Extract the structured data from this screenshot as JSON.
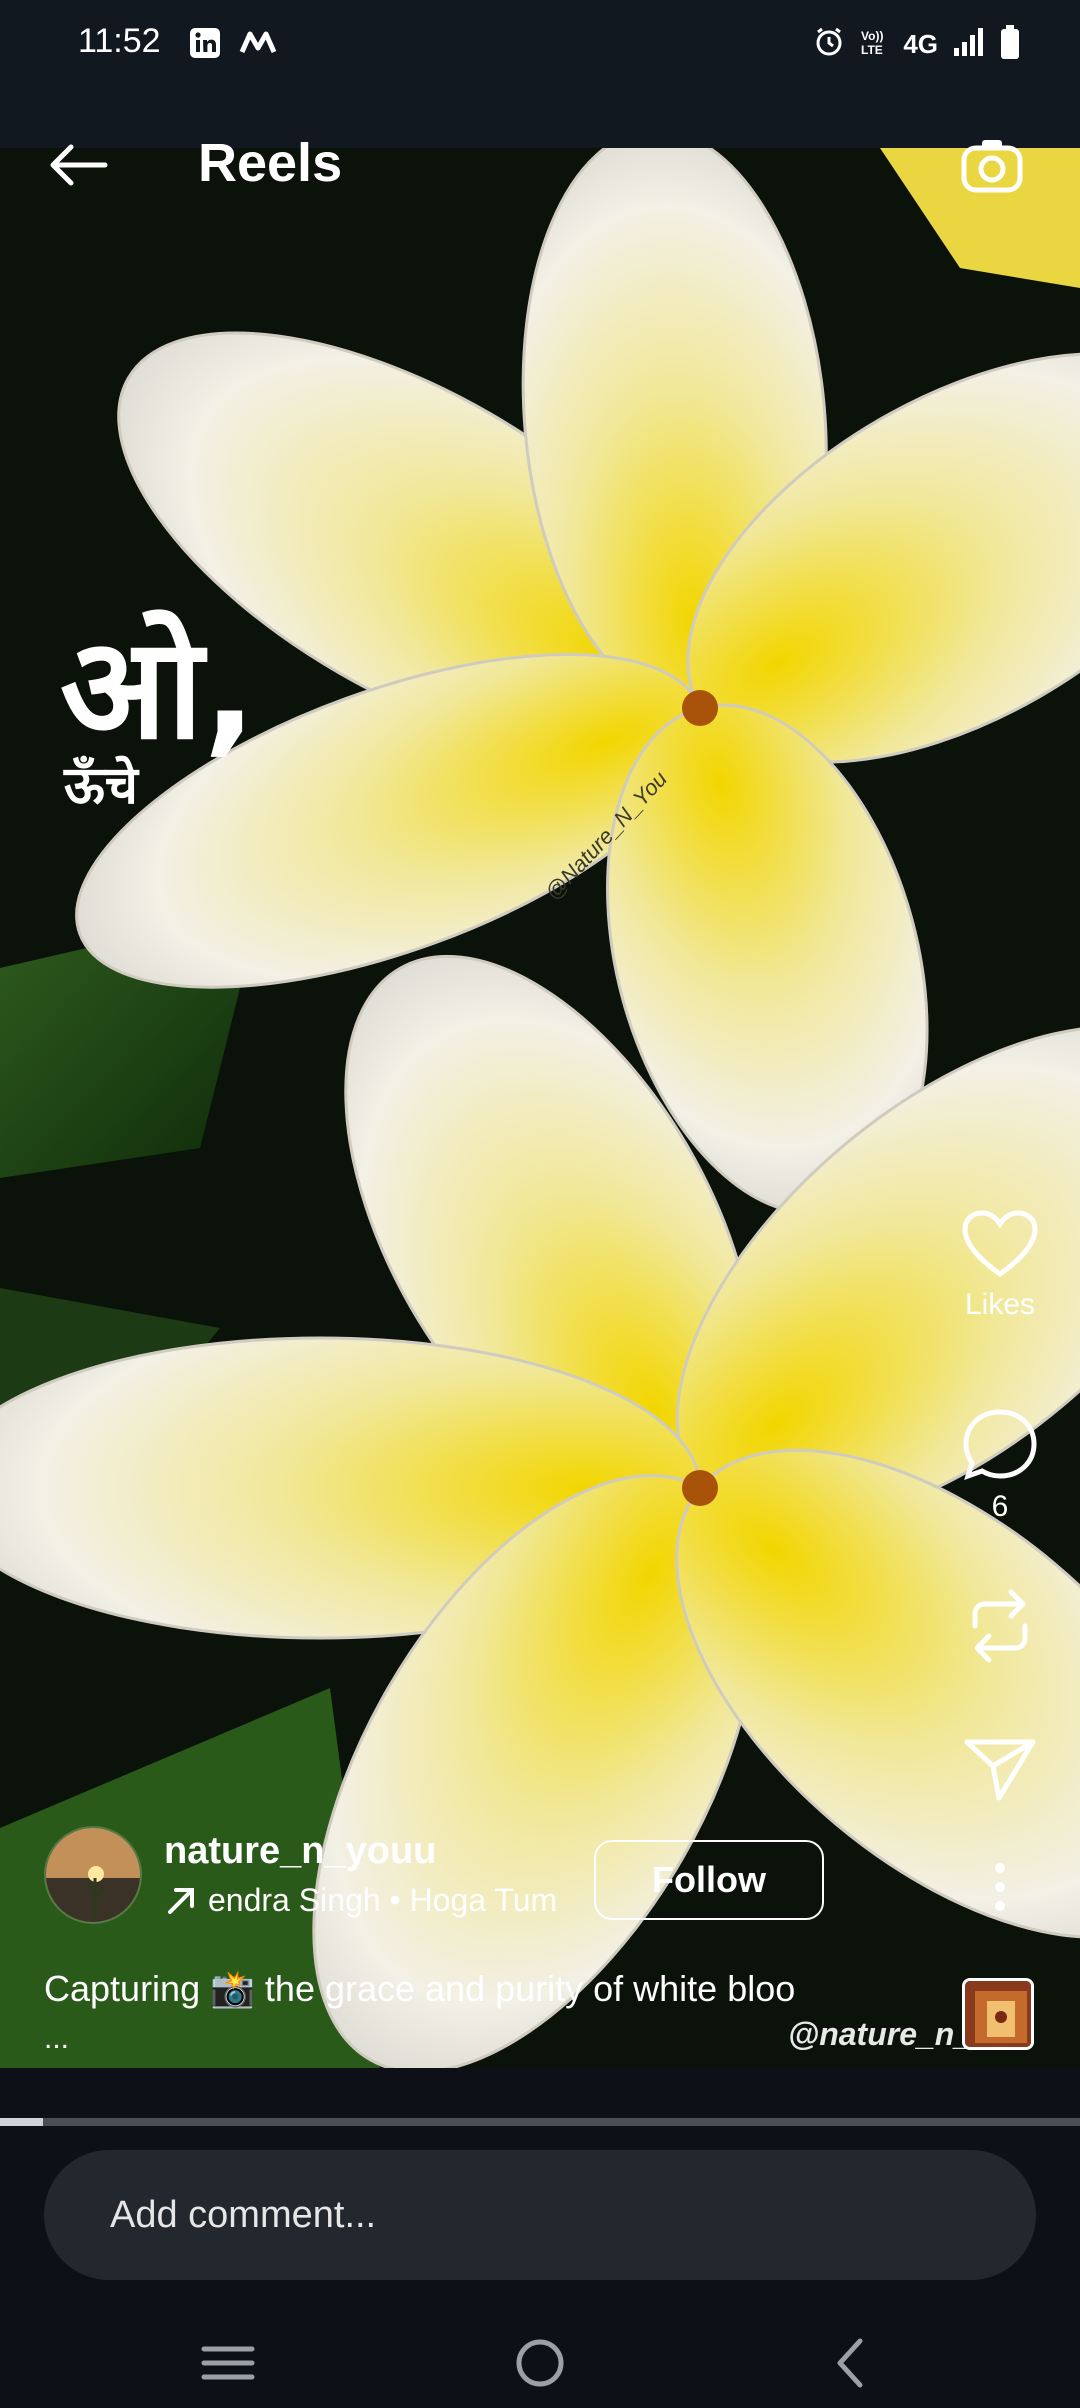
{
  "status_bar": {
    "time": "11:52",
    "right_indicators": [
      "alarm-icon",
      "volte-icon",
      "4G",
      "signal-icon",
      "battery-icon"
    ],
    "network_label": "4G"
  },
  "header": {
    "title": "Reels",
    "back_icon": "back-arrow-icon",
    "camera_icon": "camera-icon"
  },
  "video": {
    "overlay_text_1": "ओ,",
    "overlay_text_2": "ऊँचे",
    "petal_watermark": "@Nature_N_You",
    "bottom_watermark": "@nature_n_"
  },
  "actions": {
    "likes_label": "Likes",
    "comments_count": "6"
  },
  "post": {
    "username": "nature_n_youu",
    "audio": "endra Singh • Hoga Tum",
    "follow_label": "Follow",
    "caption": "Capturing 📸  the grace and purity of white bloo",
    "caption_more": "..."
  },
  "playback": {
    "progress_fraction": 0.04
  },
  "comment": {
    "placeholder": "Add comment..."
  },
  "colors": {
    "background": "#0d1117",
    "comment_field": "#23272e",
    "text": "#ffffff"
  }
}
